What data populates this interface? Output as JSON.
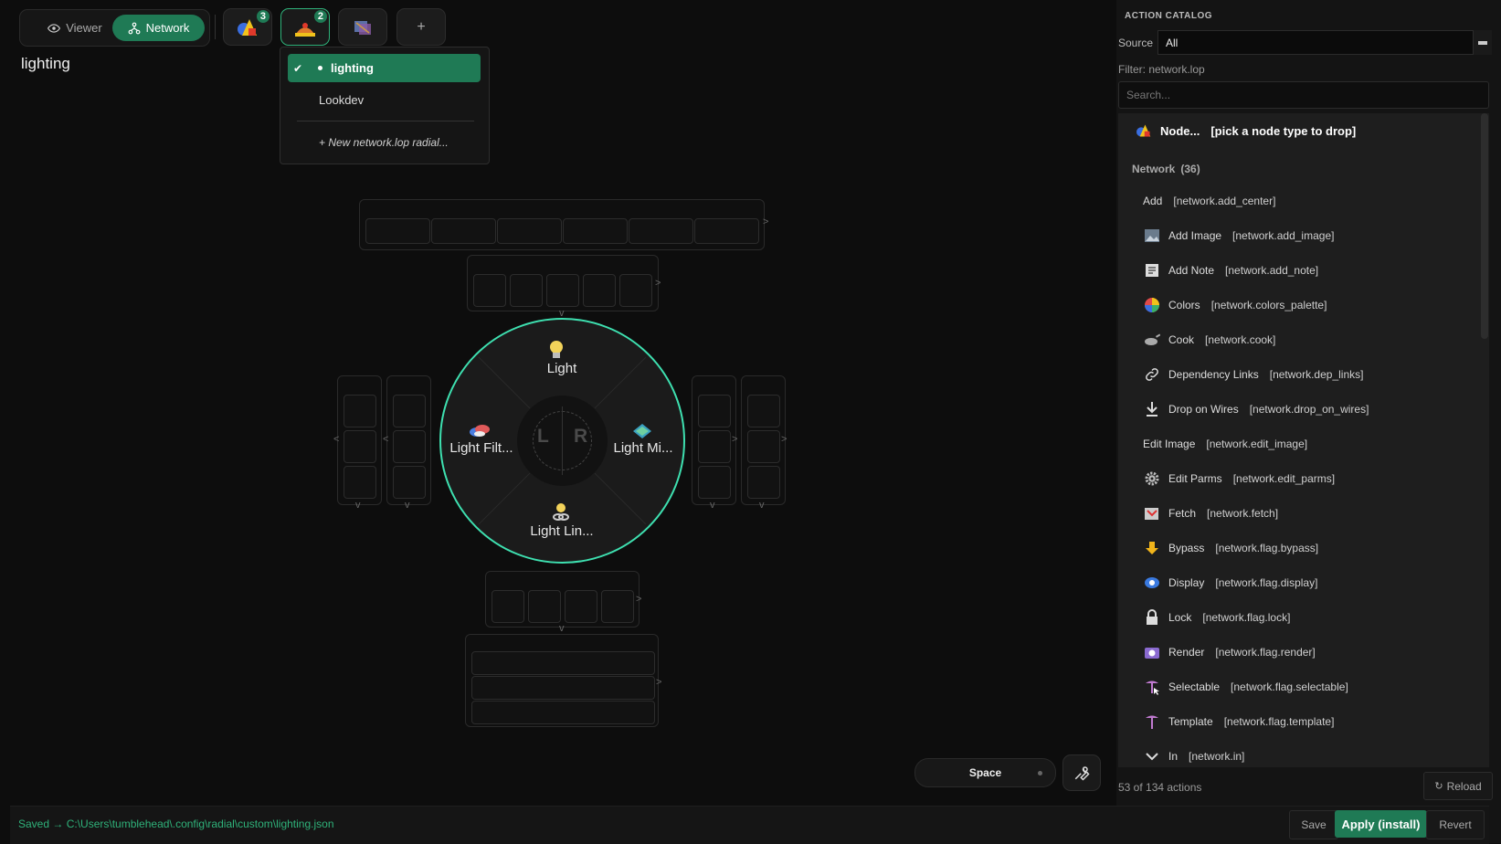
{
  "mode": {
    "viewer_label": "Viewer",
    "network_label": "Network"
  },
  "context_tabs": [
    {
      "icon": "shapes-icon",
      "badge": "3"
    },
    {
      "icon": "lop-stage-icon",
      "badge": "2"
    },
    {
      "icon": "cop-icon",
      "badge": ""
    }
  ],
  "add_tab_label": "+",
  "page_title": "lighting",
  "dropdown": {
    "items": [
      "lighting",
      "Lookdev"
    ],
    "new_label": "+ New network.lop radial..."
  },
  "radial": {
    "top_label": "Light",
    "left_label": "Light Filt...",
    "right_label": "Light Mi...",
    "bottom_label": "Light Lin...",
    "center_left": "L",
    "center_right": "R"
  },
  "space_label": "Space",
  "catalog": {
    "title": "ACTION CATALOG",
    "source_label": "Source",
    "source_value": "All",
    "filter_text": "Filter: network.lop",
    "search_placeholder": "Search...",
    "node_row": {
      "label": "Node...",
      "id": "[pick a node type to drop]"
    },
    "section": {
      "label": "Network",
      "count": "(36)"
    },
    "rows": [
      {
        "label": "Add",
        "id": "[network.add_center]",
        "icon": ""
      },
      {
        "label": "Add Image",
        "id": "[network.add_image]",
        "icon": "image-icon"
      },
      {
        "label": "Add Note",
        "id": "[network.add_note]",
        "icon": "note-icon"
      },
      {
        "label": "Colors",
        "id": "[network.colors_palette]",
        "icon": "color-wheel-icon"
      },
      {
        "label": "Cook",
        "id": "[network.cook]",
        "icon": "pan-icon"
      },
      {
        "label": "Dependency Links",
        "id": "[network.dep_links]",
        "icon": "link-icon"
      },
      {
        "label": "Drop on Wires",
        "id": "[network.drop_on_wires]",
        "icon": "download-arrow-icon"
      },
      {
        "label": "Edit Image",
        "id": "[network.edit_image]",
        "icon": ""
      },
      {
        "label": "Edit Parms",
        "id": "[network.edit_parms]",
        "icon": "gear-icon"
      },
      {
        "label": "Fetch",
        "id": "[network.fetch]",
        "icon": "fetch-icon"
      },
      {
        "label": "Bypass",
        "id": "[network.flag.bypass]",
        "icon": "bypass-arrow-icon"
      },
      {
        "label": "Display",
        "id": "[network.flag.display]",
        "icon": "eye-icon"
      },
      {
        "label": "Lock",
        "id": "[network.flag.lock]",
        "icon": "lock-icon"
      },
      {
        "label": "Render",
        "id": "[network.flag.render]",
        "icon": "camera-icon"
      },
      {
        "label": "Selectable",
        "id": "[network.flag.selectable]",
        "icon": "selectable-icon"
      },
      {
        "label": "Template",
        "id": "[network.flag.template]",
        "icon": "template-icon"
      },
      {
        "label": "In",
        "id": "[network.in]",
        "icon": "chevron-down-icon"
      }
    ],
    "footer_count": "53 of 134 actions",
    "reload_label": "Reload"
  },
  "status": {
    "message": "Saved → C:\\Users\\tumblehead\\.config\\radial\\custom\\lighting.json",
    "save_label": "Save",
    "apply_label": "Apply (install)",
    "revert_label": "Revert"
  }
}
